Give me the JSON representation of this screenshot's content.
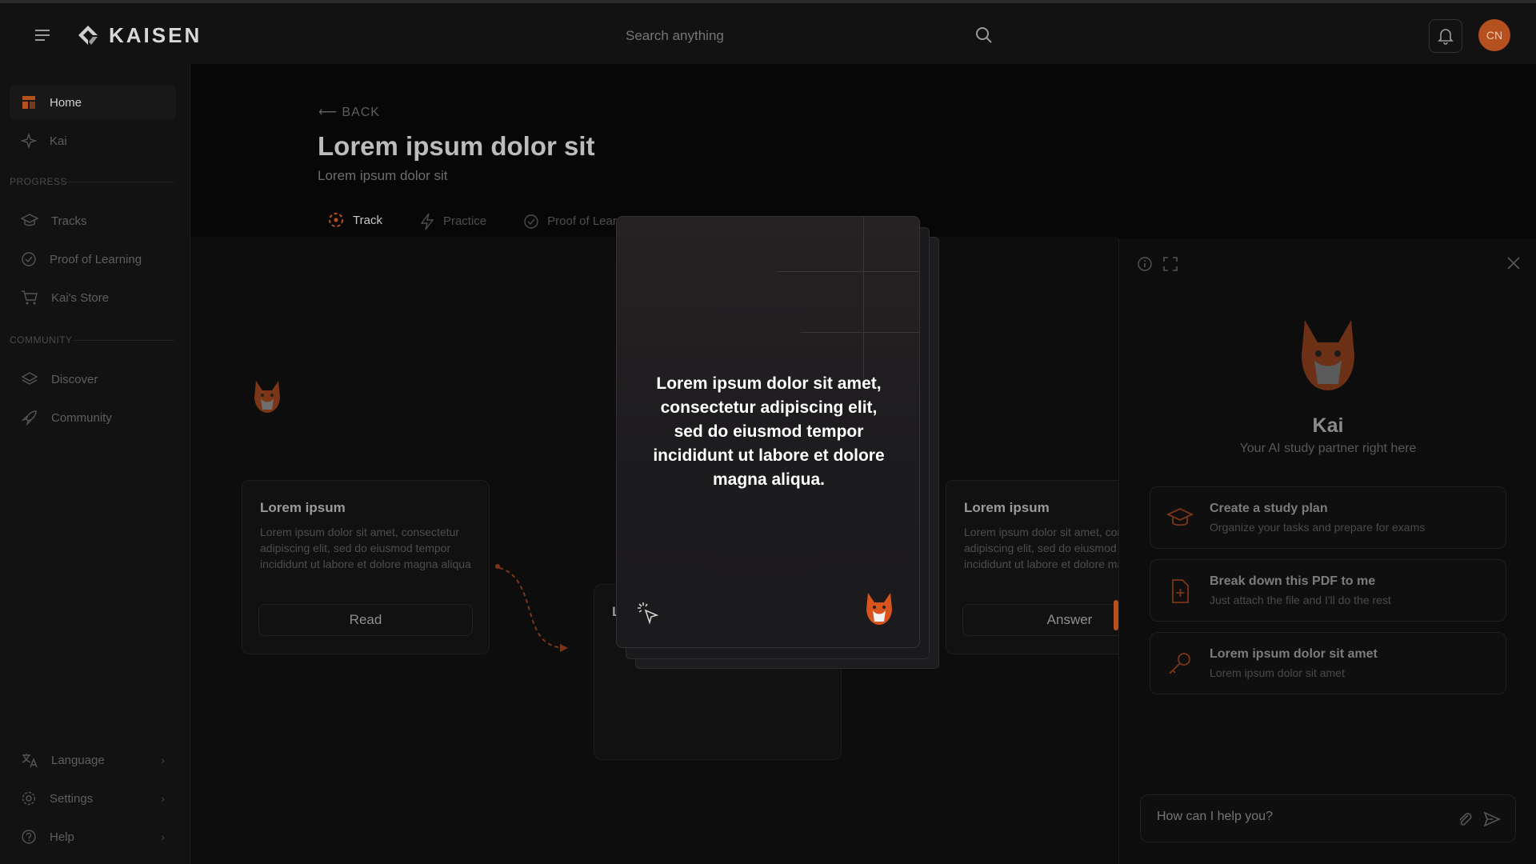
{
  "app": {
    "brand": "KAISEN",
    "accent": "#b5501f"
  },
  "header": {
    "search_placeholder": "Search anything",
    "avatar_initials": "CN"
  },
  "sidebar": {
    "items_top": [
      {
        "label": "Home",
        "icon": "home-icon"
      },
      {
        "label": "Kai",
        "icon": "sparkle-icon"
      }
    ],
    "progress_label": "PROGRESS",
    "items_progress": [
      {
        "label": "Tracks",
        "icon": "graduation-cap-icon"
      },
      {
        "label": "Proof of Learning",
        "icon": "check-circle-icon"
      },
      {
        "label": "Kai's Store",
        "icon": "cart-icon"
      }
    ],
    "community_label": "COMMUNITY",
    "items_community": [
      {
        "label": "Discover",
        "icon": "layers-icon"
      },
      {
        "label": "Community",
        "icon": "rocket-icon"
      }
    ],
    "items_bottom": [
      {
        "label": "Language",
        "icon": "translate-icon"
      },
      {
        "label": "Settings",
        "icon": "gear-icon"
      },
      {
        "label": "Help",
        "icon": "help-icon"
      }
    ]
  },
  "main": {
    "back_label": "BACK",
    "title": "Lorem ipsum dolor sit",
    "subtitle": "Lorem ipsum dolor sit",
    "tabs": [
      {
        "label": "Track",
        "icon": "track-icon"
      },
      {
        "label": "Practice",
        "icon": "bolt-icon"
      },
      {
        "label": "Proof of Learning",
        "icon": "check-circle-icon"
      }
    ],
    "cards": [
      {
        "title": "Lorem ipsum",
        "desc": "Lorem ipsum dolor sit amet, consectetur adipiscing elit, sed do eiusmod tempor incididunt ut labore et dolore magna aliqua",
        "button": "Read"
      },
      {
        "title": "Lorem ipsum",
        "desc": "Lorem ipsum dolor sit amet, consectetur adipiscing elit, sed do eiusmod tempor incididunt ut labore et dolore magna aliqua",
        "button": "Answer"
      }
    ],
    "card_partial_letter": "L"
  },
  "modal": {
    "text": "Lorem ipsum dolor sit amet, consectetur adipiscing elit, sed do eiusmod tempor incididunt ut labore et dolore magna aliqua."
  },
  "panel": {
    "name": "Kai",
    "tagline": "Your AI study partner right here",
    "actions": [
      {
        "title": "Create a study plan",
        "subtitle": "Organize your tasks and prepare for exams",
        "icon": "graduation-cap-icon"
      },
      {
        "title": "Break down this PDF to me",
        "subtitle": "Just attach the file and I'll do the rest",
        "icon": "file-plus-icon"
      },
      {
        "title": "Lorem ipsum dolor sit amet",
        "subtitle": "Lorem ipsum dolor sit amet",
        "icon": "key-icon"
      }
    ],
    "chat_placeholder": "How can I help you?"
  }
}
